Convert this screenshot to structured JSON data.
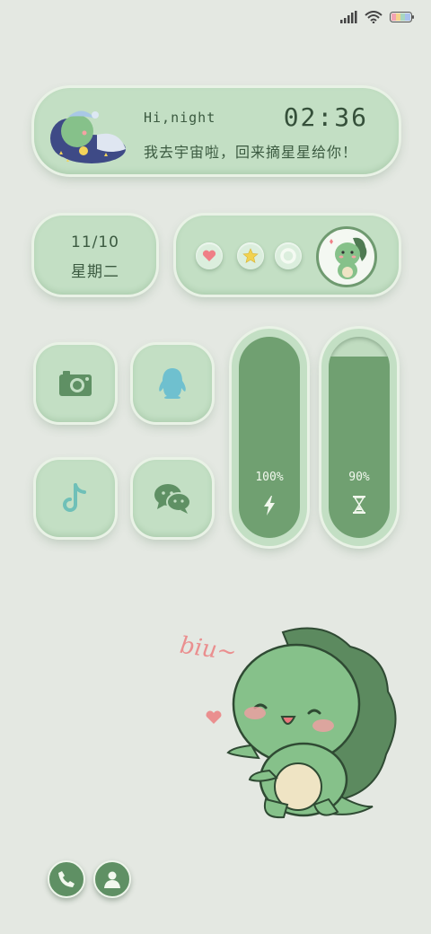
{
  "status_bar": {
    "icons": [
      "signal-icon",
      "wifi-icon",
      "battery-icon"
    ]
  },
  "greeting_widget": {
    "title": "Hi,night",
    "time": "02:36",
    "message": "我去宇宙啦，回来摘星星给你！"
  },
  "date_widget": {
    "date": "11/10",
    "weekday": "星期二"
  },
  "mood_widget": {
    "buttons": [
      "heart-icon",
      "star-icon",
      "circle-icon"
    ]
  },
  "apps": [
    {
      "name": "camera",
      "icon": "camera-icon"
    },
    {
      "name": "qq",
      "icon": "penguin-icon"
    },
    {
      "name": "tiktok",
      "icon": "music-note-icon"
    },
    {
      "name": "wechat",
      "icon": "chat-bubbles-icon"
    }
  ],
  "gauges": [
    {
      "name": "battery",
      "value_label": "100%",
      "level": 1.0,
      "icon": "lightning-icon"
    },
    {
      "name": "storage",
      "value_label": "90%",
      "level": 0.9,
      "icon": "hourglass-icon"
    }
  ],
  "illustration": {
    "caption": "biu~"
  },
  "dock": [
    {
      "name": "phone",
      "icon": "phone-icon"
    },
    {
      "name": "contacts",
      "icon": "person-icon"
    }
  ],
  "colors": {
    "background": "#e4e8e2",
    "card": "#c3dfc4",
    "accent_dark": "#70a071",
    "text": "#3b5a40",
    "pink": "#ea8f8f"
  }
}
